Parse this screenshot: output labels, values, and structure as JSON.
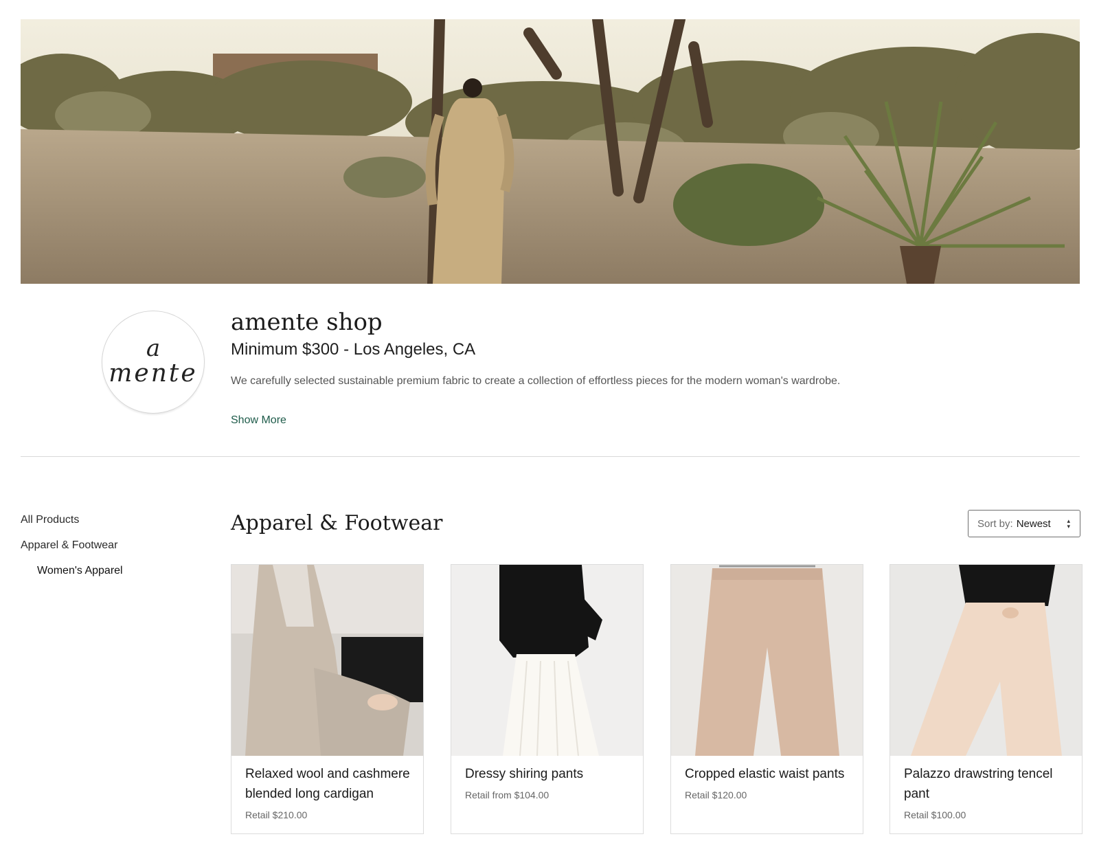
{
  "shop": {
    "name": "amente shop",
    "subtitle": "Minimum $300 - Los Angeles, CA",
    "description": "We carefully selected sustainable premium fabric to create a collection of effortless pieces for the modern woman's wardrobe.",
    "show_more": "Show More",
    "logo_line1": "a",
    "logo_line2": "mente"
  },
  "sidebar": {
    "items": [
      {
        "label": "All Products"
      },
      {
        "label": "Apparel & Footwear"
      },
      {
        "label": "Women's Apparel"
      }
    ]
  },
  "main": {
    "section_title": "Apparel & Footwear",
    "sort": {
      "label": "Sort by:",
      "value": "Newest"
    }
  },
  "products": [
    {
      "title": "Relaxed wool and cashmere blended long cardigan",
      "price": "Retail $210.00"
    },
    {
      "title": "Dressy shiring pants",
      "price": "Retail from $104.00"
    },
    {
      "title": "Cropped elastic waist pants",
      "price": "Retail $120.00"
    },
    {
      "title": "Palazzo drawstring tencel pant",
      "price": "Retail $100.00"
    }
  ],
  "colors": {
    "accent_link": "#1e5b4a",
    "desert_sand": "#b8a58a",
    "sky": "#ece7d6"
  },
  "icons": {
    "sort": "chevron-up-down-icon"
  }
}
